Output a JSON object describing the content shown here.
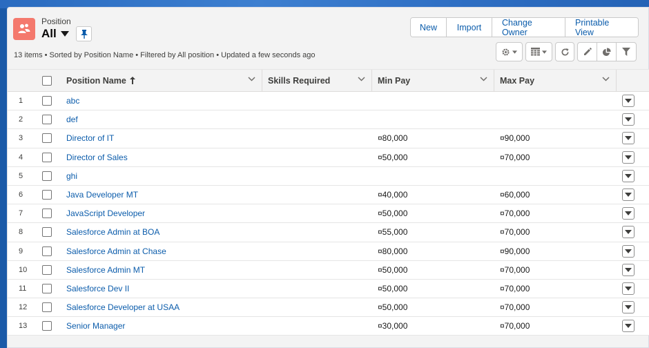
{
  "header": {
    "object_label": "Position",
    "list_view_name": "All",
    "summary": "13 items • Sorted by Position Name • Filtered by All position • Updated a few seconds ago"
  },
  "actions": {
    "new_label": "New",
    "import_label": "Import",
    "change_owner_label": "Change Owner",
    "printable_view_label": "Printable View"
  },
  "toolbar_icons": [
    "gear-icon",
    "table-icon",
    "refresh-icon",
    "pencil-icon",
    "chart-icon",
    "filter-icon"
  ],
  "table": {
    "columns": [
      "Position Name",
      "Skills Required",
      "Min Pay",
      "Max Pay"
    ],
    "rows": [
      {
        "num": "1",
        "name": "abc",
        "skills": "",
        "min": "",
        "max": ""
      },
      {
        "num": "2",
        "name": "def",
        "skills": "",
        "min": "",
        "max": ""
      },
      {
        "num": "3",
        "name": "Director of IT",
        "skills": "",
        "min": "¤80,000",
        "max": "¤90,000"
      },
      {
        "num": "4",
        "name": "Director of Sales",
        "skills": "",
        "min": "¤50,000",
        "max": "¤70,000"
      },
      {
        "num": "5",
        "name": "ghi",
        "skills": "",
        "min": "",
        "max": ""
      },
      {
        "num": "6",
        "name": "Java Developer MT",
        "skills": "",
        "min": "¤40,000",
        "max": "¤60,000"
      },
      {
        "num": "7",
        "name": "JavaScript Developer",
        "skills": "",
        "min": "¤50,000",
        "max": "¤70,000"
      },
      {
        "num": "8",
        "name": "Salesforce Admin at BOA",
        "skills": "",
        "min": "¤55,000",
        "max": "¤70,000"
      },
      {
        "num": "9",
        "name": "Salesforce Admin at Chase",
        "skills": "",
        "min": "¤80,000",
        "max": "¤90,000"
      },
      {
        "num": "10",
        "name": "Salesforce Admin MT",
        "skills": "",
        "min": "¤50,000",
        "max": "¤70,000"
      },
      {
        "num": "11",
        "name": "Salesforce Dev II",
        "skills": "",
        "min": "¤50,000",
        "max": "¤70,000"
      },
      {
        "num": "12",
        "name": "Salesforce Developer at USAA",
        "skills": "",
        "min": "¤50,000",
        "max": "¤70,000"
      },
      {
        "num": "13",
        "name": "Senior Manager",
        "skills": "",
        "min": "¤30,000",
        "max": "¤70,000"
      }
    ]
  },
  "colors": {
    "object_icon": "#f4796d",
    "link": "#0b5cab",
    "header_bg": "#f3f3f3",
    "banner": "#1b5aa8"
  }
}
